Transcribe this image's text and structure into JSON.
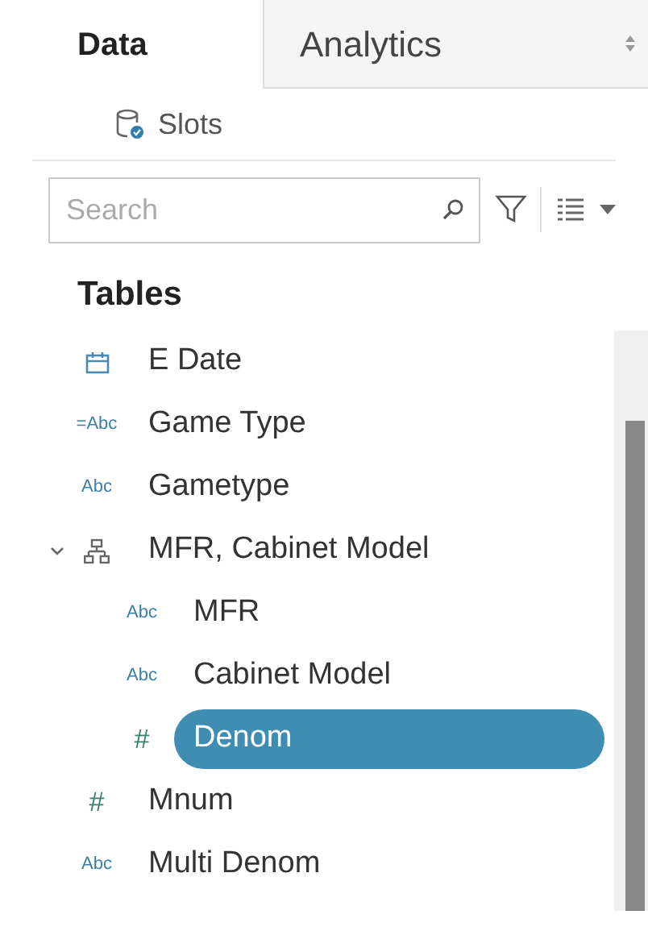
{
  "tabs": [
    {
      "label": "Data",
      "selected": true
    },
    {
      "label": "Analytics",
      "selected": false
    }
  ],
  "data_source": {
    "label": "Slots"
  },
  "search": {
    "placeholder": "Search"
  },
  "section_title": "Tables",
  "fields": [
    {
      "kind": "date",
      "label": "E Date",
      "selected": false
    },
    {
      "kind": "text",
      "type_label": "=Abc",
      "label": "Game Type",
      "selected": false
    },
    {
      "kind": "text",
      "type_label": "Abc",
      "label": "Gametype",
      "selected": false
    },
    {
      "kind": "hierarchy",
      "label": "MFR, Cabinet Model",
      "expanded": true,
      "selected": false,
      "children": [
        {
          "kind": "text",
          "type_label": "Abc",
          "label": "MFR",
          "selected": false
        },
        {
          "kind": "text",
          "type_label": "Abc",
          "label": "Cabinet Model",
          "selected": false
        },
        {
          "kind": "text",
          "type_label": "#",
          "label": "Denom",
          "selected": true
        }
      ]
    },
    {
      "kind": "text",
      "type_label": "#",
      "label": "Mnum",
      "selected": false
    },
    {
      "kind": "text",
      "type_label": "Abc",
      "label": "Multi Denom",
      "selected": false
    }
  ]
}
